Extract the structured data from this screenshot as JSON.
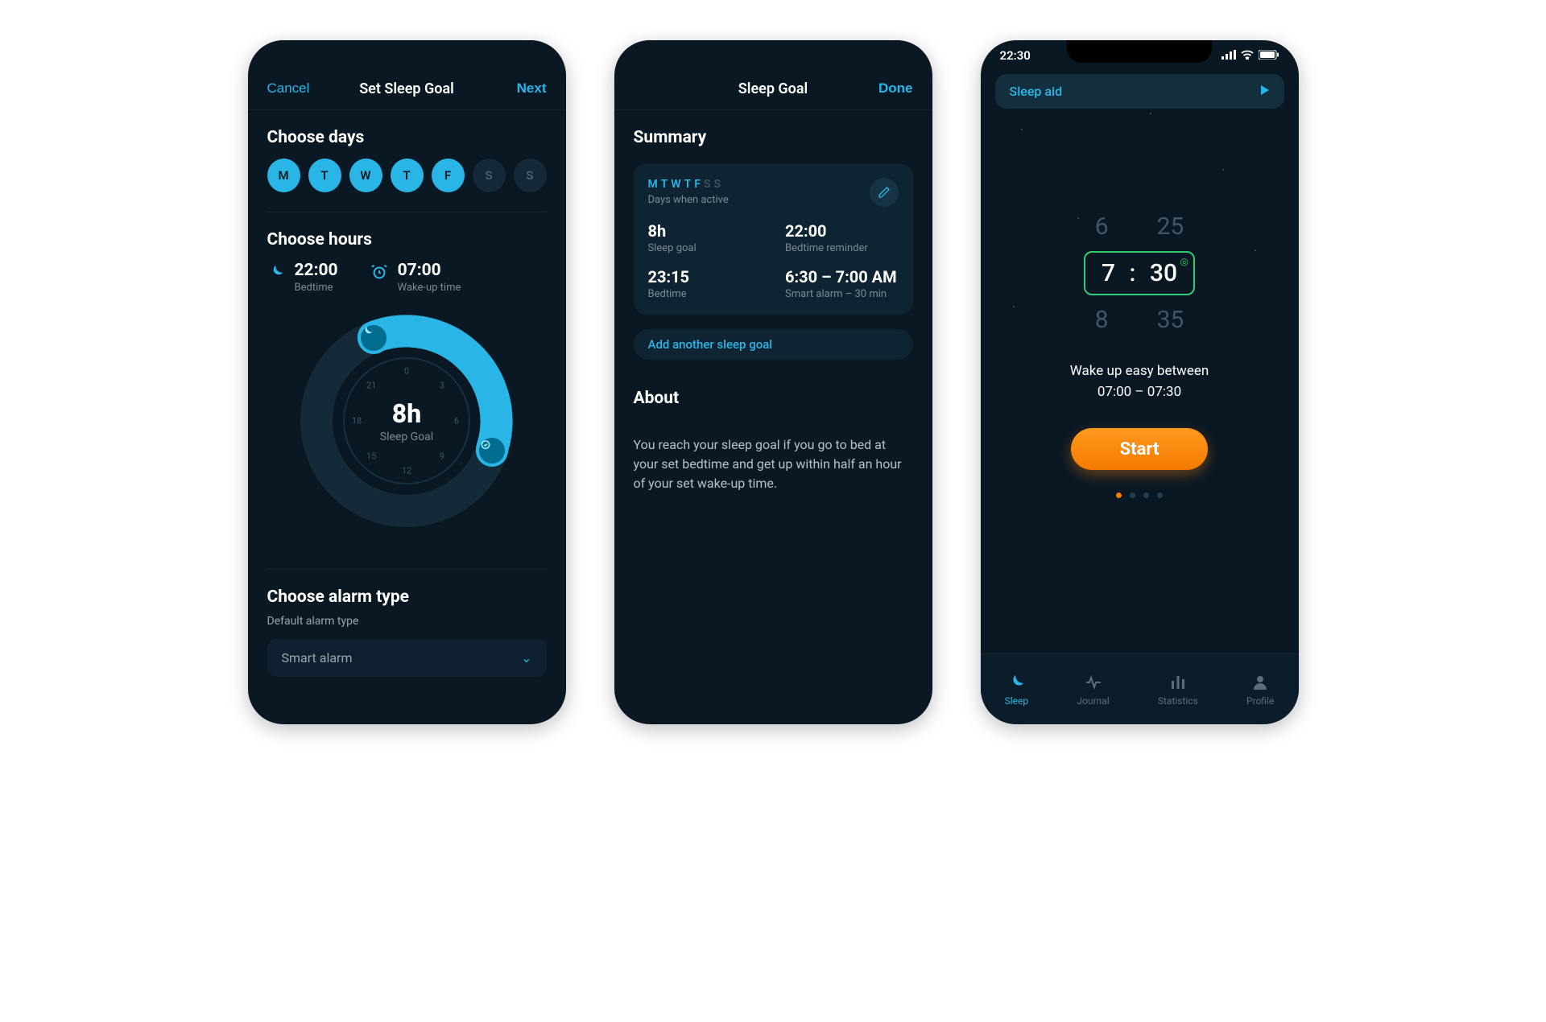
{
  "screen1": {
    "cancel": "Cancel",
    "title": "Set Sleep Goal",
    "next": "Next",
    "choose_days": "Choose days",
    "days": [
      "M",
      "T",
      "W",
      "T",
      "F",
      "S",
      "S"
    ],
    "days_active": [
      true,
      true,
      true,
      true,
      true,
      false,
      false
    ],
    "choose_hours": "Choose hours",
    "bedtime_val": "22:00",
    "bedtime_lab": "Bedtime",
    "wakeup_val": "07:00",
    "wakeup_lab": "Wake-up time",
    "dial_value": "8h",
    "dial_label": "Sleep Goal",
    "dial_ticks": [
      "0",
      "3",
      "6",
      "9",
      "12",
      "15",
      "18",
      "21"
    ],
    "choose_alarm": "Choose alarm type",
    "default_alarm": "Default alarm type",
    "smart_alarm": "Smart alarm"
  },
  "screen2": {
    "title": "Sleep Goal",
    "done": "Done",
    "summary": "Summary",
    "days": [
      "M",
      "T",
      "W",
      "T",
      "F",
      "S",
      "S"
    ],
    "days_active": [
      true,
      true,
      true,
      true,
      true,
      false,
      false
    ],
    "days_sub": "Days when active",
    "sleep_goal_val": "8h",
    "sleep_goal_lab": "Sleep goal",
    "bed_rem_val": "22:00",
    "bed_rem_lab": "Bedtime reminder",
    "bedtime_val": "23:15",
    "bedtime_lab": "Bedtime",
    "alarm_val": "6:30 – 7:00 AM",
    "alarm_lab": "Smart alarm – 30 min",
    "add_another": "Add another sleep goal",
    "about": "About",
    "about_text": "You reach your sleep goal if you go to bed at your set bedtime and get up within half an hour of your set wake-up time."
  },
  "screen3": {
    "time": "22:30",
    "sleep_aid": "Sleep aid",
    "picker_prev_h": "6",
    "picker_prev_m": "25",
    "picker_sel_h": "7",
    "picker_sel_m": "30",
    "picker_next_h": "8",
    "picker_next_m": "35",
    "wake_line1": "Wake up easy between",
    "wake_line2": "07:00 – 07:30",
    "start": "Start",
    "tabs": {
      "sleep": "Sleep",
      "journal": "Journal",
      "statistics": "Statistics",
      "profile": "Profile"
    }
  }
}
